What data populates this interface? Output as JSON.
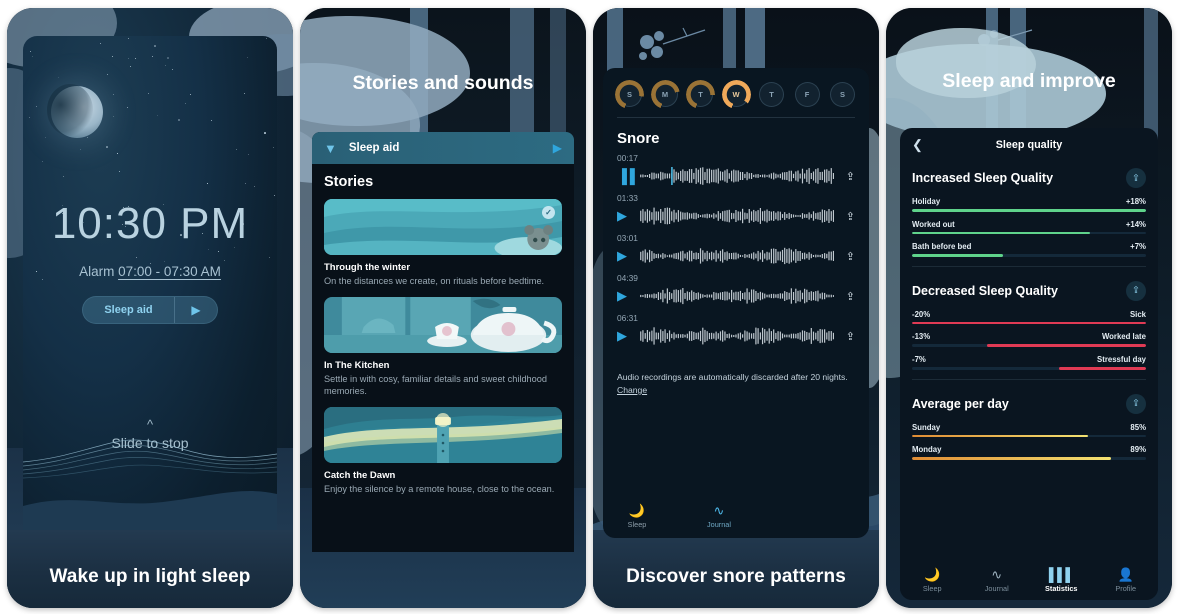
{
  "panels": [
    {
      "caption": "Wake up in light sleep",
      "clock": "10:30 PM",
      "alarm_prefix": "Alarm ",
      "alarm_range": "07:00 - 07:30 AM",
      "sleep_aid_label": "Sleep aid",
      "play_icon": "play-icon",
      "slide_text": "Slide to stop",
      "chevron_icon": "chevron-up-icon",
      "moon_icon": "moon-icon"
    },
    {
      "caption": "Stories and sounds",
      "title": "Stories and sounds",
      "aid_bar": {
        "label": "Sleep aid",
        "chevron_icon": "chevron-down-icon",
        "play_icon": "play-icon"
      },
      "section_title": "Stories",
      "stories": [
        {
          "title": "Through the winter",
          "desc": "On the distances we create, on rituals before bedtime.",
          "checked": true,
          "check_icon": "check-circle-icon"
        },
        {
          "title": "In The Kitchen",
          "desc": "Settle in with cosy, familiar details and sweet childhood memories.",
          "checked": false
        },
        {
          "title": "Catch the Dawn",
          "desc": "Enjoy the silence by a remote house, close to the ocean.",
          "checked": false
        }
      ]
    },
    {
      "caption": "Discover snore patterns",
      "days": [
        {
          "letter": "S",
          "active": false,
          "progress": 72
        },
        {
          "letter": "M",
          "active": false,
          "progress": 66
        },
        {
          "letter": "T",
          "active": false,
          "progress": 70
        },
        {
          "letter": "W",
          "active": true,
          "progress": 80
        },
        {
          "letter": "T",
          "active": false,
          "progress": 0
        },
        {
          "letter": "F",
          "active": false,
          "progress": 0
        },
        {
          "letter": "S",
          "active": false,
          "progress": 0
        }
      ],
      "section_title": "Snore",
      "recordings": [
        {
          "time": "00:17",
          "state": "playing",
          "icon": "pause-icon",
          "share_icon": "share-icon"
        },
        {
          "time": "01:33",
          "state": "paused",
          "icon": "play-icon",
          "share_icon": "share-icon"
        },
        {
          "time": "03:01",
          "state": "paused",
          "icon": "play-icon",
          "share_icon": "share-icon"
        },
        {
          "time": "04:39",
          "state": "paused",
          "icon": "play-icon",
          "share_icon": "share-icon"
        },
        {
          "time": "06:31",
          "state": "paused",
          "icon": "play-icon",
          "share_icon": "share-icon"
        }
      ],
      "note": "Audio recordings are automatically discarded after 20 nights. ",
      "note_link": "Change",
      "nav": [
        {
          "label": "Sleep",
          "icon": "moon-icon",
          "active": false
        },
        {
          "label": "Journal",
          "icon": "waveform-icon",
          "active": true
        }
      ]
    },
    {
      "caption": "Sleep and improve",
      "title": "Sleep and improve",
      "header": {
        "back_icon": "chevron-left-icon",
        "title": "Sleep quality"
      },
      "groups": [
        {
          "title": "Increased Sleep Quality",
          "share_icon": "share-icon",
          "align": "left",
          "color": "#5fd38b",
          "rows": [
            {
              "label": "Holiday",
              "value": "+18%",
              "pct": 100
            },
            {
              "label": "Worked out",
              "value": "+14%",
              "pct": 76
            },
            {
              "label": "Bath before bed",
              "value": "+7%",
              "pct": 39
            }
          ]
        },
        {
          "title": "Decreased Sleep Quality",
          "share_icon": "share-icon",
          "align": "right",
          "color": "#e03a54",
          "rows": [
            {
              "label": "Sick",
              "value": "-20%",
              "pct": 100
            },
            {
              "label": "Worked late",
              "value": "-13%",
              "pct": 68
            },
            {
              "label": "Stressful day",
              "value": "-7%",
              "pct": 37
            }
          ]
        },
        {
          "title": "Average per day",
          "share_icon": "share-icon",
          "align": "left",
          "color": "gradient-orange",
          "rows": [
            {
              "label": "Sunday",
              "value": "85%",
              "pct": 75
            },
            {
              "label": "Monday",
              "value": "89%",
              "pct": 85
            }
          ]
        }
      ],
      "nav": [
        {
          "label": "Sleep",
          "icon": "moon-icon",
          "active": false
        },
        {
          "label": "Journal",
          "icon": "waveform-icon",
          "active": false
        },
        {
          "label": "Statistics",
          "icon": "bar-chart-icon",
          "active": true
        },
        {
          "label": "Profile",
          "icon": "person-icon",
          "active": false
        }
      ]
    }
  ],
  "colors": {
    "accent_blue": "#2fa6dd",
    "teal": "#2d6b82",
    "green": "#5fd38b",
    "red": "#e03a54",
    "orange": "#e8a33d",
    "yellow": "#f2e06a"
  }
}
